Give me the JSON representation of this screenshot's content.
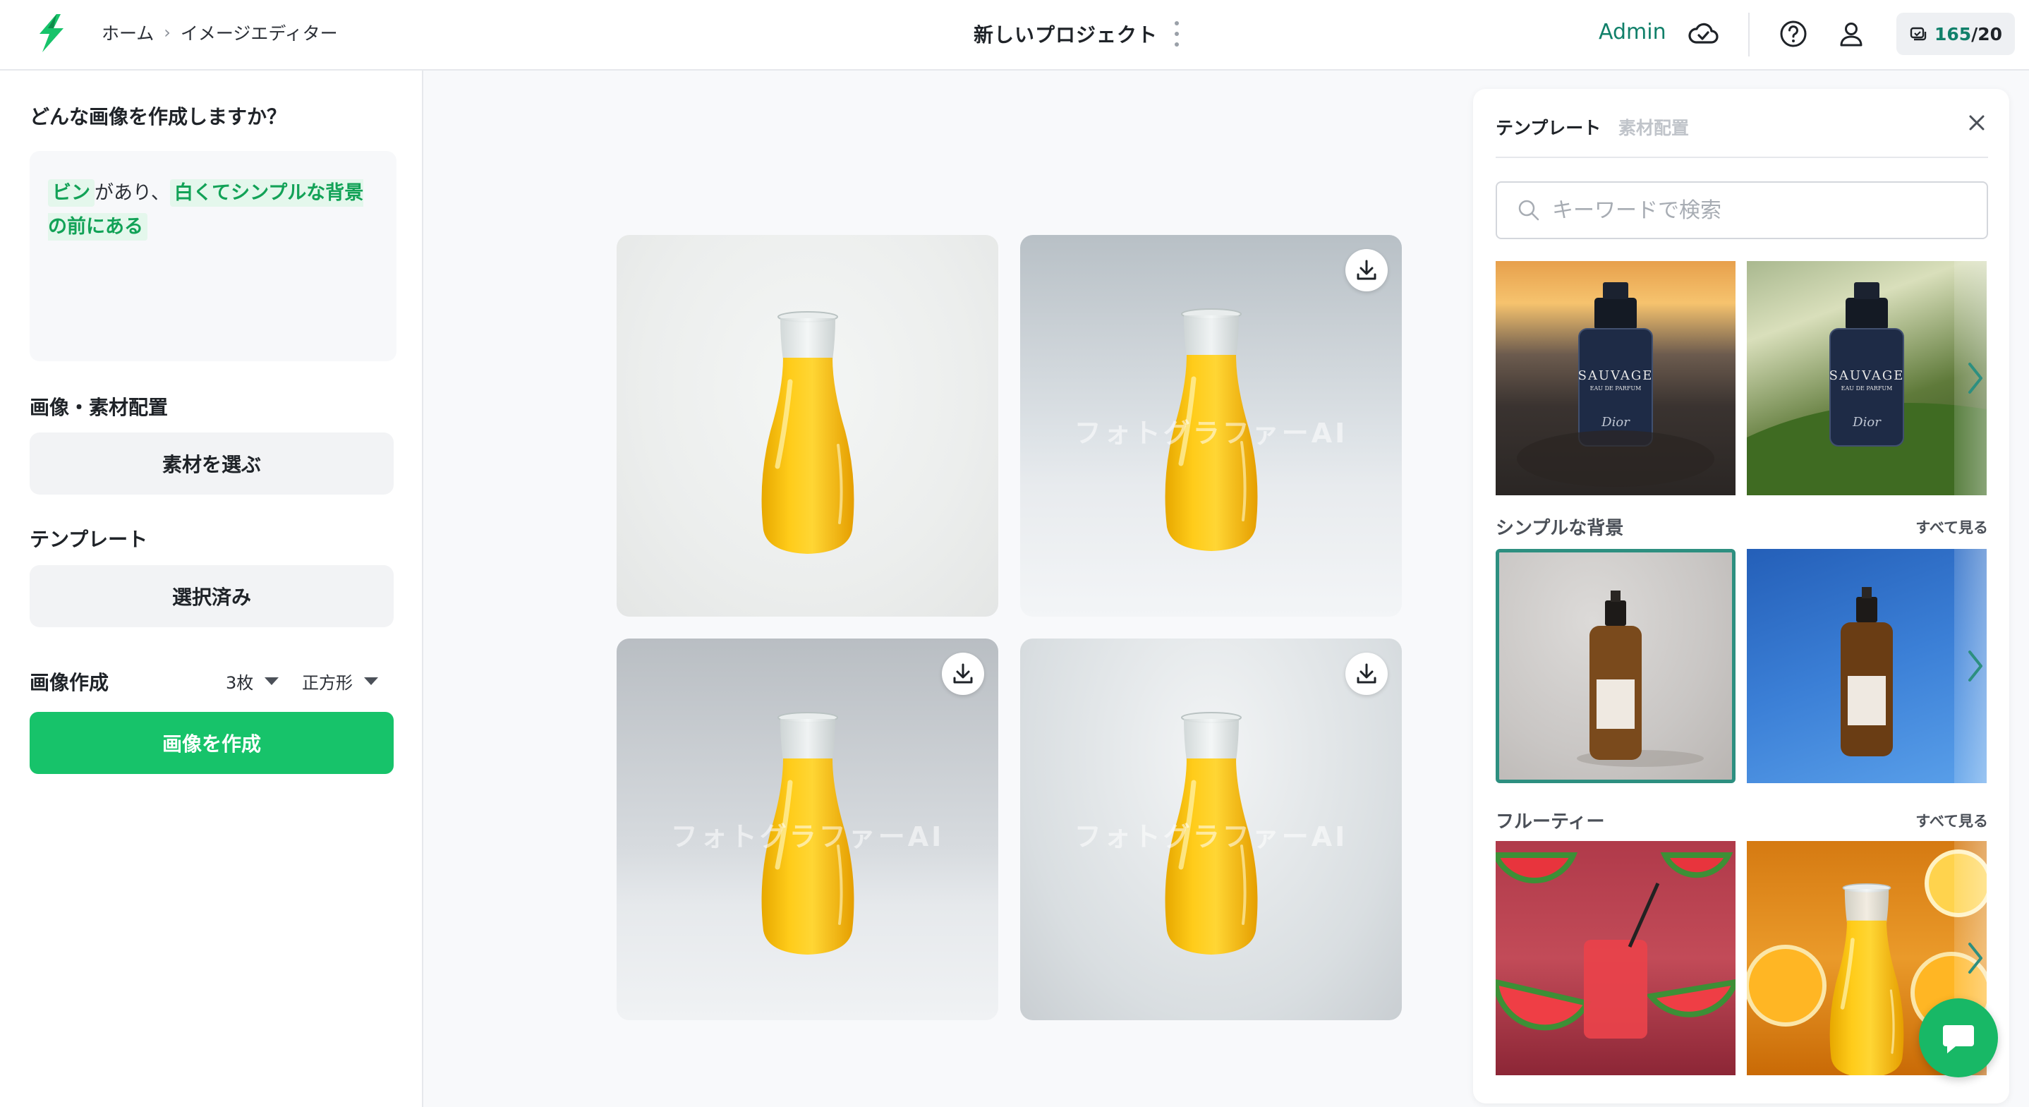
{
  "header": {
    "breadcrumb": {
      "home": "ホーム",
      "separator": "›",
      "current": "イメージエディター"
    },
    "project_title": "新しいプロジェクト",
    "user_name": "Admin",
    "credits": {
      "used": "165",
      "separator": "/",
      "total": "20"
    }
  },
  "left_panel": {
    "prompt_heading": "どんな画像を作成しますか？",
    "prompt": {
      "chip1": "ビン",
      "text1": "があり、",
      "chip2": "白くてシンプルな背景の前にある"
    },
    "assets_heading": "画像・素材配置",
    "choose_assets_label": "素材を選ぶ",
    "template_heading": "テンプレート",
    "template_selected_label": "選択済み",
    "create_heading": "画像作成",
    "count_value": "3枚",
    "shape_value": "正方形",
    "create_button_label": "画像を作成"
  },
  "results": {
    "watermark": "フォトグラファーAI"
  },
  "right_panel": {
    "tab_templates": "テンプレート",
    "tab_asset_layout": "素材配置",
    "search_placeholder": "キーワードで検索",
    "featured_label_brand": "SAUVAGE",
    "featured_label_sub": "EAU DE PARFUM",
    "featured_label_maker": "Dior",
    "section_simple": "シンプルな背景",
    "section_fruity": "フルーティー",
    "see_all": "すべて見る"
  },
  "colors": {
    "accent_green": "#17c36a",
    "admin_teal": "#11806a",
    "chip_bg": "#e4f7ec",
    "chip_text": "#12a257",
    "selected_border": "#2d8f80"
  },
  "icons": {
    "logo": "fotographer-logo-icon",
    "cloud": "cloud-sync-icon",
    "help": "help-circle-icon",
    "user": "user-icon",
    "credits": "credits-icon",
    "download": "download-icon",
    "close": "close-icon",
    "search": "search-icon",
    "next": "chevron-right-icon",
    "chat": "chat-bubble-icon"
  }
}
